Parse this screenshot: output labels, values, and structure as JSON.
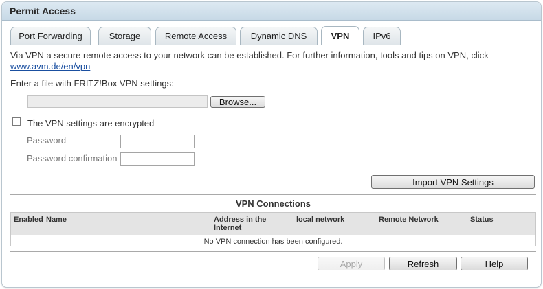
{
  "panel": {
    "title": "Permit Access"
  },
  "tabs": [
    {
      "label": "Port Forwarding",
      "active": false
    },
    {
      "label": "Storage",
      "active": false
    },
    {
      "label": "Remote Access",
      "active": false
    },
    {
      "label": "Dynamic DNS",
      "active": false
    },
    {
      "label": "VPN",
      "active": true
    },
    {
      "label": "IPv6",
      "active": false
    }
  ],
  "intro": {
    "text": "Via VPN a secure remote access to your network can be established. For further information, tools and tips on VPN, click",
    "link": "www.avm.de/en/vpn"
  },
  "file": {
    "label": "Enter a file with FRITZ!Box VPN settings:",
    "browse_label": "Browse...",
    "value": ""
  },
  "encrypted": {
    "label": "The VPN settings are encrypted",
    "checked": false
  },
  "password": {
    "label": "Password",
    "value": ""
  },
  "password_confirm": {
    "label": "Password confirmation",
    "value": ""
  },
  "import_button": "Import VPN Settings",
  "connections": {
    "title": "VPN Connections",
    "columns": [
      "Enabled",
      "Name",
      "Address in the Internet",
      "local network",
      "Remote Network",
      "Status"
    ],
    "empty_message": "No VPN connection has been configured."
  },
  "footer": {
    "apply_label": "Apply",
    "refresh_label": "Refresh",
    "help_label": "Help"
  }
}
